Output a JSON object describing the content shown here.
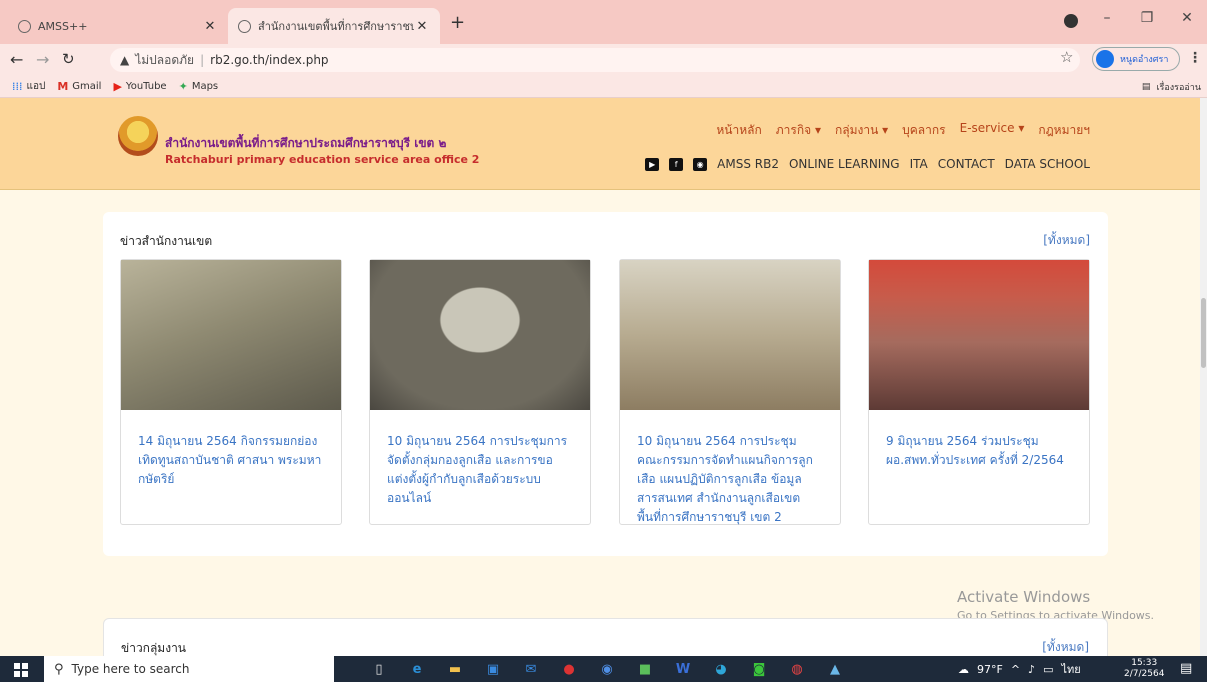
{
  "browser": {
    "tabs": [
      {
        "title": "AMSS++",
        "active": false
      },
      {
        "title": "สำนักงานเขตพื้นที่การศึกษาราชบุรี เข",
        "active": true
      }
    ],
    "new_tab": "+",
    "window_controls": [
      "–",
      "❐",
      "✕"
    ],
    "address": {
      "security": "ไม่ปลอดภัย",
      "url": "rb2.go.th/index.php"
    },
    "profile_name": "หนูดอำงศรา",
    "bookmarks": [
      {
        "label": "แอป",
        "icon": "apps-icon"
      },
      {
        "label": "Gmail",
        "icon": "gmail-icon"
      },
      {
        "label": "YouTube",
        "icon": "youtube-icon"
      },
      {
        "label": "Maps",
        "icon": "maps-icon"
      }
    ],
    "reading_list": "เรื่องรออ่าน"
  },
  "site": {
    "org_name_th": "สำนักงานเขตพื้นที่การศึกษาประถมศึกษาราชบุรี เขต ๒",
    "org_name_en": "Ratchaburi primary education service area office 2",
    "main_nav": [
      "หน้าหลัก",
      "ภารกิจ ▾",
      "กลุ่มงาน ▾",
      "บุคลากร",
      "E-service ▾",
      "กฎหมายฯ"
    ],
    "sub_nav": [
      "AMSS RB2",
      "ONLINE LEARNING",
      "ITA",
      "CONTACT",
      "DATA SCHOOL"
    ],
    "social_icons": [
      "youtube-icon",
      "facebook-icon",
      "line-icon"
    ]
  },
  "news": {
    "title": "ข่าวสำนักงานเขต",
    "all_link": "[ทั้งหมด]",
    "items": [
      {
        "caption": "14 มิถุนายน 2564 กิจกรรมยกย่องเทิดทูนสถาบันชาติ ศาสนา พระมหากษัตริย์",
        "image_color": "#8f8a72"
      },
      {
        "caption": "10 มิถุนายน 2564 การประชุมการจัดตั้งกลุ่มกองลูกเสือ และการขอแต่งตั้งผู้กำกับลูกเสือด้วยระบบออนไลน์",
        "image_color": "#6e6a5e"
      },
      {
        "caption": "10 มิถุนายน 2564 การประชุมคณะกรรมการจัดทำแผนกิจการลูกเสือ แผนปฏิบัติการลูกเสือ ข้อมูลสารสนเทศ สำนักงานลูกเสือเขตพื้นที่การศึกษาราชบุรี เขต 2",
        "image_color": "#b7ab90"
      },
      {
        "caption": "9 มิถุนายน 2564 ร่วมประชุม ผอ.สพท.ทั่วประเทศ ครั้งที่ 2/2564",
        "image_color": "#a56b5e"
      }
    ]
  },
  "groups": {
    "title": "ข่าวกลุ่มงาน",
    "all_link": "[ทั้งหมด]"
  },
  "watermark": {
    "line1": "Activate Windows",
    "line2": "Go to Settings to activate Windows."
  },
  "taskbar": {
    "search_placeholder": "Type here to search",
    "weather": "97°F",
    "ime": "ไทย",
    "time": "15:33",
    "date": "2/7/2564"
  }
}
